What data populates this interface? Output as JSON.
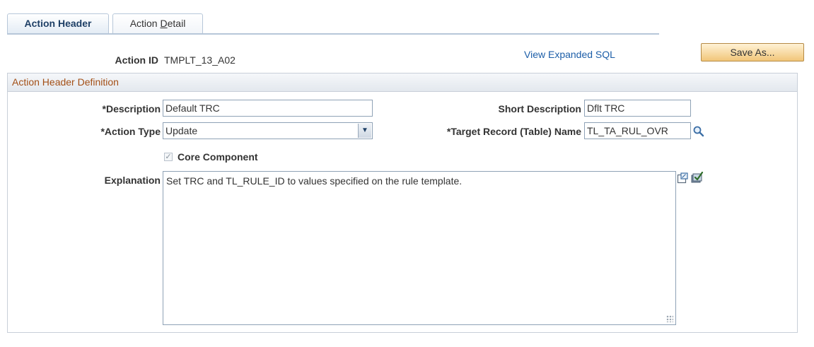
{
  "tabs": [
    {
      "label": "Action Header",
      "active": true
    },
    {
      "label": "Action Detail",
      "mnemonic": "D"
    }
  ],
  "header": {
    "action_id_label": "Action ID",
    "action_id_value": "TMPLT_13_A02",
    "view_sql_link": "View Expanded SQL",
    "save_as_button": "Save As..."
  },
  "group": {
    "title": "Action Header Definition",
    "description": {
      "label": "*Description",
      "value": "Default TRC"
    },
    "short_description": {
      "label": "Short Description",
      "value": "Dflt TRC"
    },
    "action_type": {
      "label": "*Action Type",
      "value": "Update"
    },
    "target_record": {
      "label": "*Target Record (Table) Name",
      "value": "TL_TA_RUL_OVR"
    },
    "core_component": {
      "label": "Core Component",
      "checked": true
    },
    "explanation": {
      "label": "Explanation",
      "value": "Set TRC and TL_RULE_ID to values specified on the rule template."
    }
  },
  "icons": {
    "lookup": "magnifier-icon",
    "expand": "expand-popup-icon",
    "spellcheck": "spellcheck-icon"
  },
  "colors": {
    "tab_border": "#b7c7d9",
    "link": "#1c5ea8",
    "group_title": "#a34f16",
    "button_fill": "#f1c679"
  }
}
